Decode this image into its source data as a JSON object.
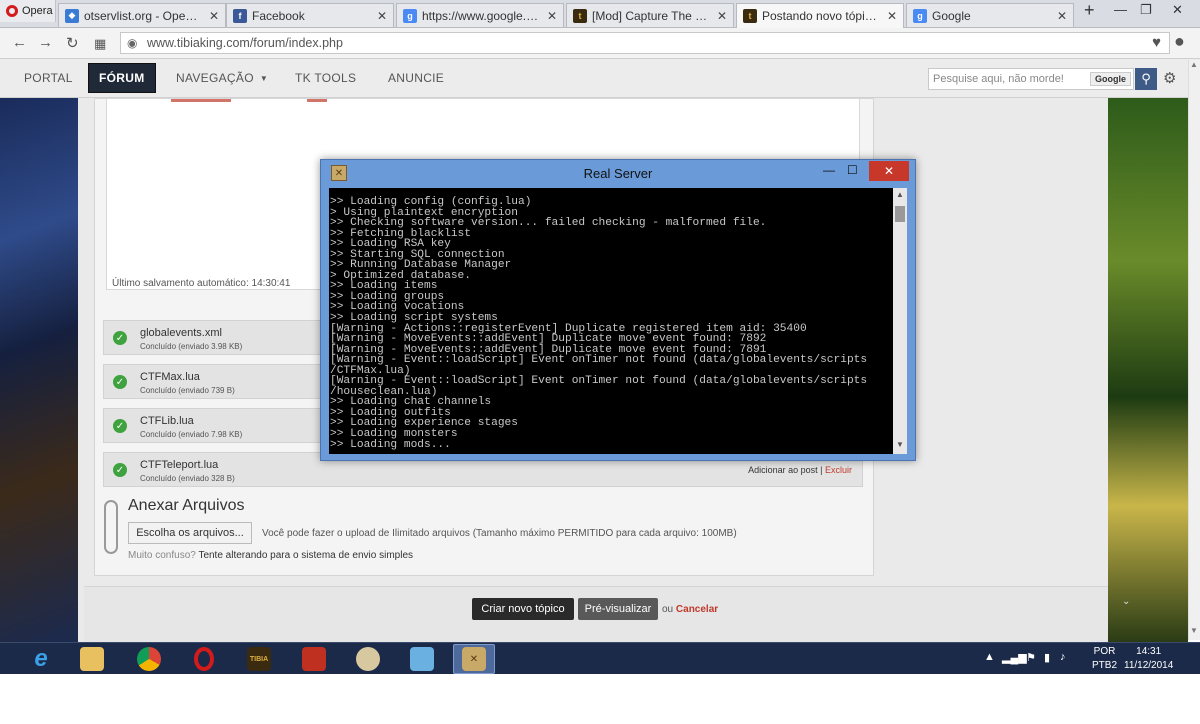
{
  "browser": {
    "opera_label": "Opera",
    "tabs": [
      {
        "title": "otservlist.org - Open Tibia",
        "icon": "otservlist-favicon",
        "active": false
      },
      {
        "title": "Facebook",
        "icon": "facebook-favicon",
        "active": false
      },
      {
        "title": "https://www.google.com",
        "icon": "google-favicon",
        "active": false
      },
      {
        "title": "[Mod] Capture The Flag(C",
        "icon": "tibiaking-favicon",
        "active": false
      },
      {
        "title": "Postando novo tópico - Ti",
        "icon": "tibiaking-favicon",
        "active": true
      },
      {
        "title": "Google",
        "icon": "google-favicon",
        "active": false
      }
    ],
    "new_tab": "+",
    "url": "www.tibiaking.com/forum/index.php"
  },
  "site_nav": {
    "items": [
      {
        "label": "PORTAL",
        "active": false
      },
      {
        "label": "FÓRUM",
        "active": true
      },
      {
        "label": "NAVEGAÇÃO",
        "active": false
      },
      {
        "label": "TK TOOLS",
        "active": false
      },
      {
        "label": "ANUNCIE",
        "active": false
      }
    ],
    "search_placeholder": "Pesquise aqui, não morde!",
    "search_badge": "Google"
  },
  "editor": {
    "autosave": "Último salvamento automático: 14:30:41"
  },
  "files": [
    {
      "name": "globalevents.xml",
      "status": "Concluído (enviado 3.98 KB)",
      "show_actions": false
    },
    {
      "name": "CTFMax.lua",
      "status": "Concluído (enviado 739 B)",
      "show_actions": false
    },
    {
      "name": "CTFLib.lua",
      "status": "Concluído (enviado 7.98 KB)",
      "show_actions": false
    },
    {
      "name": "CTFTeleport.lua",
      "status": "Concluído (enviado 328 B)",
      "show_actions": true
    }
  ],
  "file_actions": {
    "add": "Adicionar ao post",
    "sep": "|",
    "delete": "Excluir"
  },
  "attach": {
    "heading": "Anexar Arquivos",
    "choose_button": "Escolha os arquivos...",
    "upload_info": "Você pode fazer o upload de Ilimitado arquivos (Tamanho máximo PERMITIDO para cada arquivo: 100MB)",
    "confused": "Muito confuso?",
    "simple_link": "Tente alterando para o sistema de envio simples"
  },
  "actions": {
    "create": "Criar novo tópico",
    "preview": "Pré-visualizar",
    "or": "ou",
    "cancel": "Cancelar"
  },
  "console": {
    "title": "Real Server",
    "lines": [
      ">> Loading config (config.lua)",
      "> Using plaintext encryption",
      ">> Checking software version... failed checking - malformed file.",
      ">> Fetching blacklist",
      ">> Loading RSA key",
      ">> Starting SQL connection",
      ">> Running Database Manager",
      "> Optimized database.",
      ">> Loading items",
      ">> Loading groups",
      ">> Loading vocations",
      ">> Loading script systems",
      "[Warning - Actions::registerEvent] Duplicate registered item aid: 35400",
      "[Warning - MoveEvents::addEvent] Duplicate move event found: 7892",
      "[Warning - MoveEvents::addEvent] Duplicate move event found: 7891",
      "[Warning - Event::loadScript] Event onTimer not found (data/globalevents/scripts",
      "/CTFMax.lua)",
      "[Warning - Event::loadScript] Event onTimer not found (data/globalevents/scripts",
      "/houseclean.lua)",
      ">> Loading chat channels",
      ">> Loading outfits",
      ">> Loading experience stages",
      ">> Loading monsters",
      ">> Loading mods..."
    ]
  },
  "taskbar": {
    "lang_top": "POR",
    "lang_bottom": "PTB2",
    "time": "14:31",
    "date": "11/12/2014"
  },
  "colors": {
    "accent": "#1f2937",
    "console_bg": "#000000",
    "ok": "#3ea33e",
    "danger": "#c0392b"
  }
}
